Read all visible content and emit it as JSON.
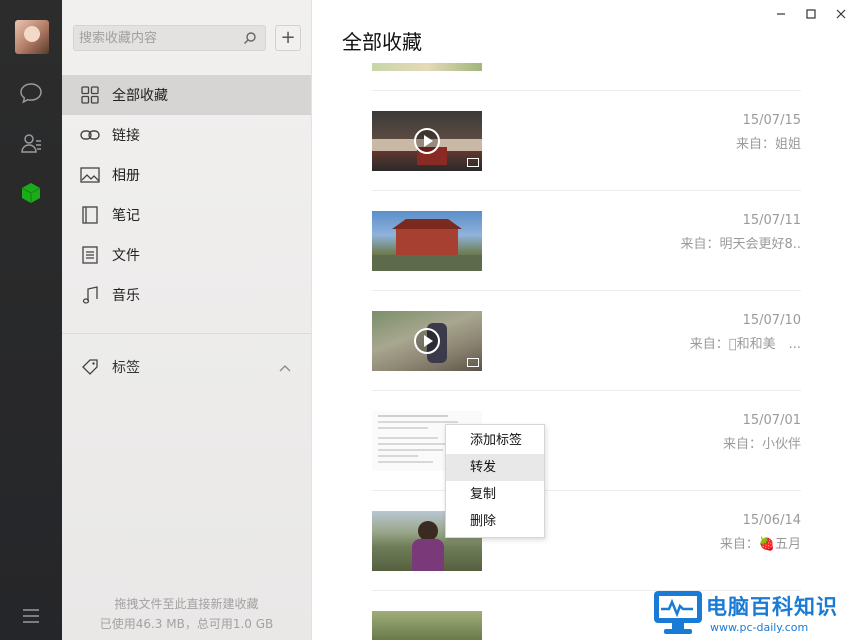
{
  "search": {
    "placeholder": "搜索收藏内容"
  },
  "nav": {
    "items": [
      {
        "label": "全部收藏",
        "icon": "grid-icon",
        "active": true
      },
      {
        "label": "链接",
        "icon": "link-icon"
      },
      {
        "label": "相册",
        "icon": "image-icon"
      },
      {
        "label": "笔记",
        "icon": "notebook-icon"
      },
      {
        "label": "文件",
        "icon": "file-icon"
      },
      {
        "label": "音乐",
        "icon": "music-note-icon"
      }
    ],
    "tags_label": "标签"
  },
  "footer": {
    "line1": "拖拽文件至此直接新建收藏",
    "line2": "已使用46.3 MB，总可用1.0 GB"
  },
  "main": {
    "title": "全部收藏",
    "items": [
      {
        "date": "15/07/15",
        "source": "来自：姐姐",
        "type": "video"
      },
      {
        "date": "15/07/11",
        "source": "来自：明天会更好8..",
        "type": "image"
      },
      {
        "date": "15/07/10",
        "source": "来自：\u0000和和美　...",
        "type": "video"
      },
      {
        "date": "15/07/01",
        "source": "来自：小伙伴",
        "type": "note"
      },
      {
        "date": "15/06/14",
        "source": "来自：🍓五月",
        "type": "image"
      }
    ]
  },
  "context_menu": {
    "items": [
      "添加标签",
      "转发",
      "复制",
      "删除"
    ],
    "hovered_index": 1
  },
  "watermark": {
    "text": "电脑百科知识",
    "url": "www.pc-daily.com"
  },
  "colors": {
    "accent_green": "#1aad19",
    "watermark_blue": "#1a7bd6",
    "rail_bg": "#2a2a2b"
  }
}
